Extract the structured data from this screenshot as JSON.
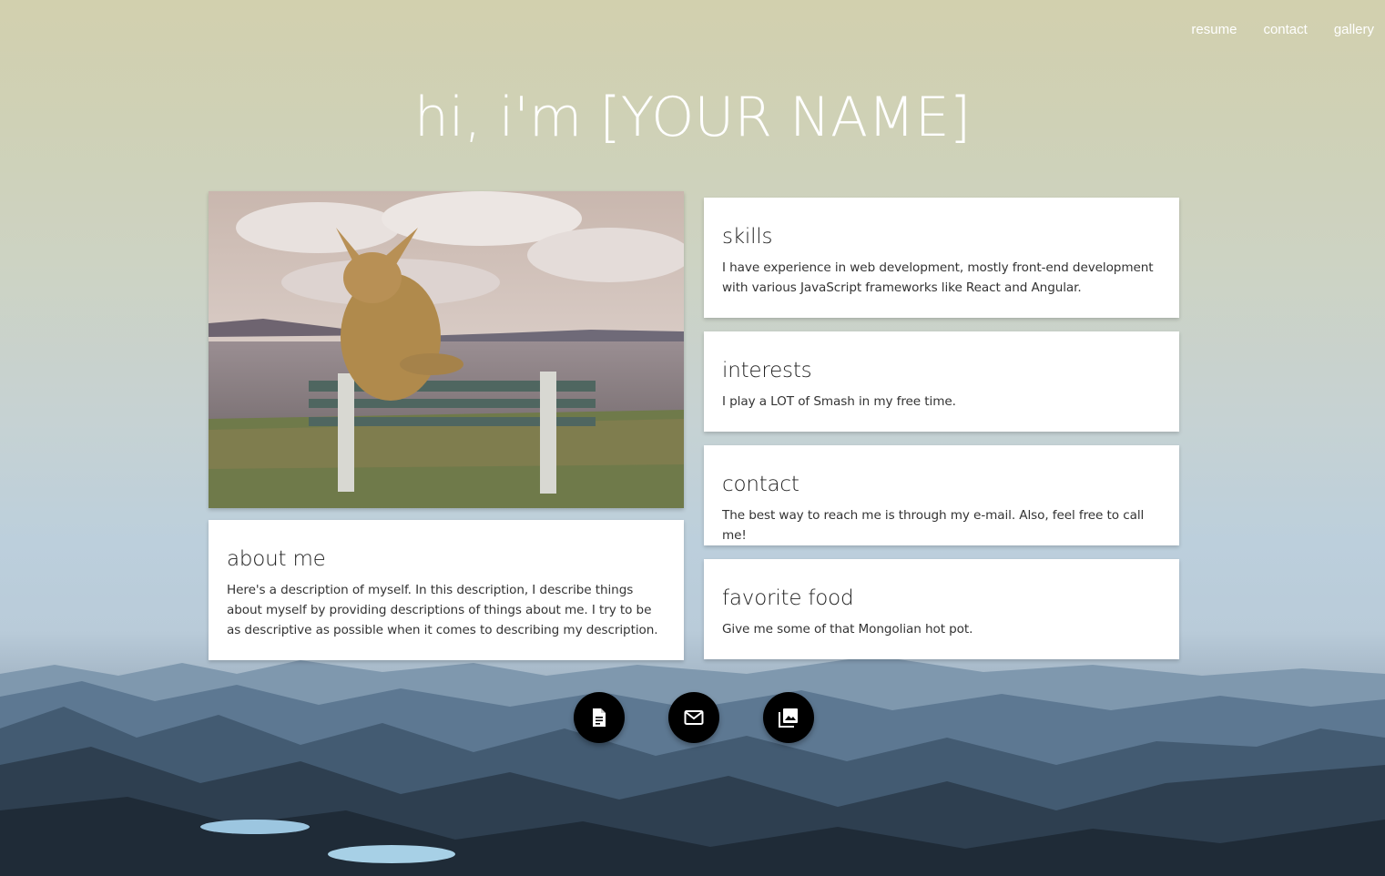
{
  "nav": {
    "items": [
      {
        "label": "resume"
      },
      {
        "label": "contact"
      },
      {
        "label": "gallery"
      }
    ]
  },
  "hero": {
    "title": "hi, i'm [YOUR NAME]"
  },
  "cards": {
    "about": {
      "title": "about me",
      "body": "Here's a description of myself. In this description, I describe things about myself by providing descriptions of things about me. I try to be as descriptive as possible when it comes to describing my description."
    },
    "skills": {
      "title": "skills",
      "body": "I have experience in web development, mostly front-end development with various JavaScript frameworks like React and Angular."
    },
    "interests": {
      "title": "interests",
      "body": "I play a LOT of Smash in my free time."
    },
    "contact": {
      "title": "contact",
      "body": "The best way to reach me is through my e-mail. Also, feel free to call me!"
    },
    "food": {
      "title": "favorite food",
      "body": "Give me some of that Mongolian hot pot."
    }
  },
  "fabs": [
    {
      "icon": "document-icon"
    },
    {
      "icon": "mail-icon"
    },
    {
      "icon": "photo-library-icon"
    }
  ],
  "colors": {
    "fab": "#000000",
    "card": "#ffffff",
    "nav_text": "#ffffff"
  }
}
